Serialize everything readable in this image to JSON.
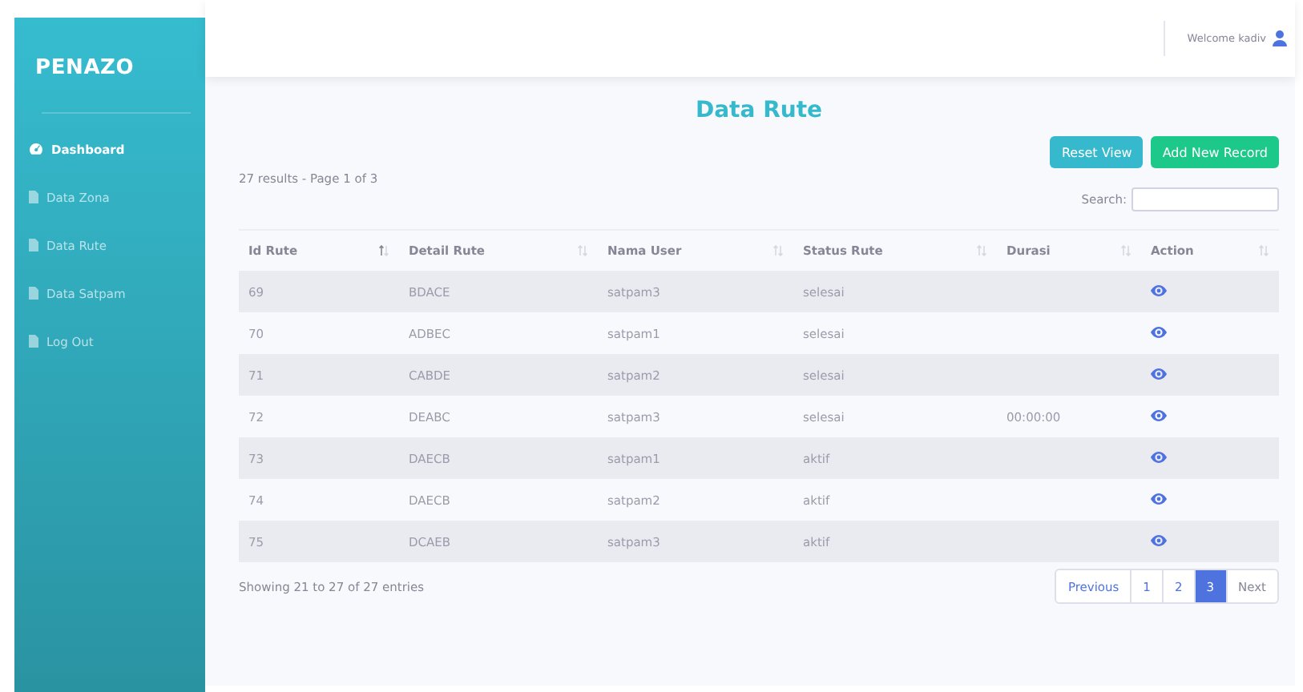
{
  "sidebar": {
    "brand": "PENAZO",
    "items": [
      {
        "label": "Dashboard",
        "kind": "dashboard",
        "selected": true
      },
      {
        "label": "Data Zona",
        "kind": "page",
        "selected": false
      },
      {
        "label": "Data Rute",
        "kind": "page",
        "selected": false
      },
      {
        "label": "Data Satpam",
        "kind": "page",
        "selected": false
      },
      {
        "label": "Log Out",
        "kind": "page",
        "selected": false
      }
    ]
  },
  "topbar": {
    "welcome": "Welcome kadiv"
  },
  "page_title": "Data Rute",
  "buttons": [
    {
      "label": "Reset View",
      "kind": "info"
    },
    {
      "label": "Add New Record",
      "kind": "success"
    }
  ],
  "results_info": "27 results - Page 1 of 3",
  "search": {
    "label": "Search:"
  },
  "table": {
    "columns": [
      {
        "label": "Id Rute",
        "sorted": true
      },
      {
        "label": "Detail Rute",
        "sorted": false
      },
      {
        "label": "Nama User",
        "sorted": false
      },
      {
        "label": "Status Rute",
        "sorted": false
      },
      {
        "label": "Durasi",
        "sorted": false
      },
      {
        "label": "Action",
        "sorted": false
      }
    ],
    "rows": [
      {
        "cells": [
          "69",
          "BDACE",
          "satpam3",
          "selesai",
          ""
        ]
      },
      {
        "cells": [
          "70",
          "ADBEC",
          "satpam1",
          "selesai",
          ""
        ]
      },
      {
        "cells": [
          "71",
          "CABDE",
          "satpam2",
          "selesai",
          ""
        ]
      },
      {
        "cells": [
          "72",
          "DEABC",
          "satpam3",
          "selesai",
          "00:00:00"
        ]
      },
      {
        "cells": [
          "73",
          "DAECB",
          "satpam1",
          "aktif",
          ""
        ]
      },
      {
        "cells": [
          "74",
          "DAECB",
          "satpam2",
          "aktif",
          ""
        ]
      },
      {
        "cells": [
          "75",
          "DCAEB",
          "satpam3",
          "aktif",
          ""
        ]
      }
    ]
  },
  "footer_info": "Showing 21 to 27 of 27 entries",
  "pagination": {
    "previous": {
      "label": "Previous",
      "disabled": false
    },
    "pages": [
      {
        "label": "1",
        "selected": false
      },
      {
        "label": "2",
        "selected": false
      },
      {
        "label": "3",
        "selected": true
      }
    ],
    "next": {
      "label": "Next",
      "disabled": true
    }
  }
}
